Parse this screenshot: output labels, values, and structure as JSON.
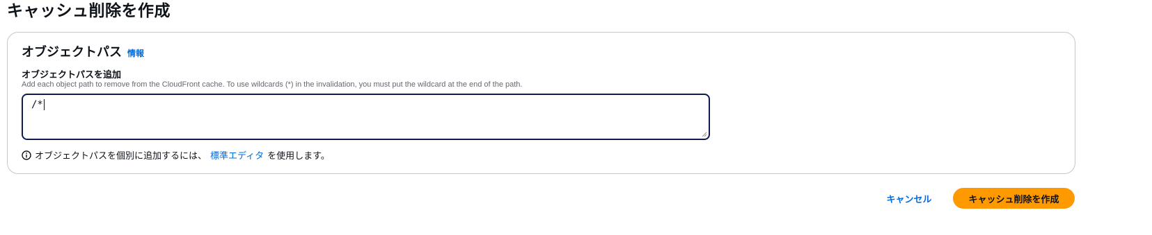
{
  "page": {
    "title": "キャッシュ削除を作成"
  },
  "section": {
    "title": "オブジェクトパス",
    "info_label": "情報"
  },
  "field": {
    "label": "オブジェクトパスを追加",
    "description": "Add each object path to remove from the CloudFront cache. To use wildcards (*) in the invalidation, you must put the wildcard at the end of the path.",
    "value": "/*"
  },
  "hint": {
    "prefix": "オブジェクトパスを個別に追加するには、",
    "link": "標準エディタ",
    "suffix": "を使用します。"
  },
  "actions": {
    "cancel_label": "キャンセル",
    "submit_label": "キャッシュ削除を作成"
  },
  "colors": {
    "accent": "#006ce0",
    "primary_button": "#ff9900",
    "focus_border": "#0f1b4f"
  }
}
